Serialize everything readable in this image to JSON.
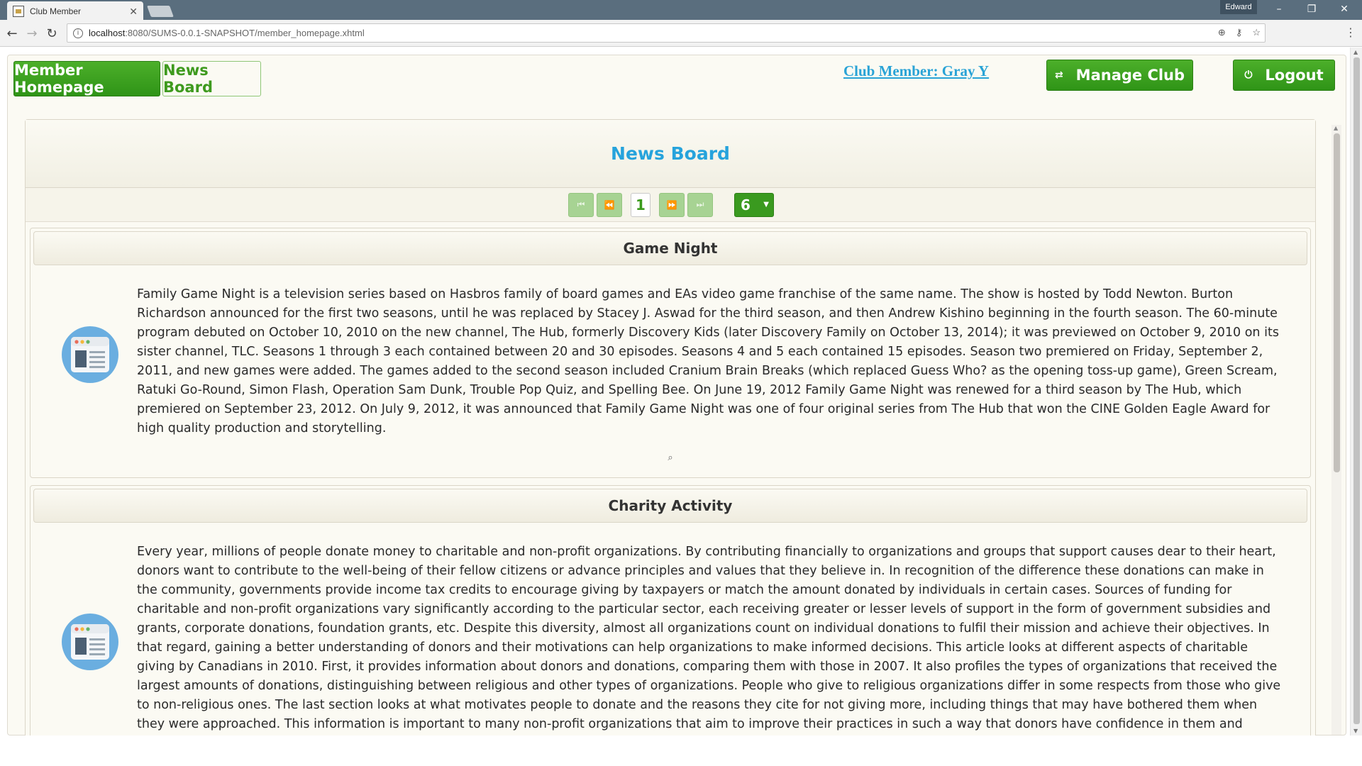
{
  "browser": {
    "tab_title": "Club Member",
    "profile_name": "Edward",
    "url_host": "localhost",
    "url_path": ":8080/SUMS-0.0.1-SNAPSHOT/member_homepage.xhtml"
  },
  "nav": {
    "member_homepage": "Member Homepage",
    "news_board": "News Board",
    "member_link": "Club Member: Gray Y",
    "manage_club": "Manage Club",
    "logout": "Logout"
  },
  "board": {
    "title": "News Board",
    "paginator": {
      "current_page": "1",
      "rows_per_page": "6"
    }
  },
  "news": [
    {
      "title": "Game Night",
      "body": "Family Game Night is a television series based on Hasbros family of board games and EAs video game franchise of the same name. The show is hosted by Todd Newton. Burton Richardson announced for the first two seasons, until he was replaced by Stacey J. Aswad for the third season, and then Andrew Kishino beginning in the fourth season. The 60-minute program debuted on October 10, 2010 on the new channel, The Hub, formerly Discovery Kids (later Discovery Family on October 13, 2014); it was previewed on October 9, 2010 on its sister channel, TLC. Seasons 1 through 3 each contained between 20 and 30 episodes. Seasons 4 and 5 each contained 15 episodes. Season two premiered on Friday, September 2, 2011, and new games were added. The games added to the second season included Cranium Brain Breaks (which replaced Guess Who? as the opening toss-up game), Green Scream, Ratuki Go-Round, Simon Flash, Operation Sam Dunk, Trouble Pop Quiz, and Spelling Bee. On June 19, 2012 Family Game Night was renewed for a third season by The Hub, which premiered on September 23, 2012. On July 9, 2012, it was announced that Family Game Night was one of four original series from The Hub that won the CINE Golden Eagle Award for high quality production and storytelling."
    },
    {
      "title": "Charity Activity",
      "body": "Every year, millions of people donate money to charitable and non-profit organizations. By contributing financially to organizations and groups that support causes dear to their heart, donors want to contribute to the well-being of their fellow citizens or advance principles and values that they believe in. In recognition of the difference these donations can make in the community, governments provide income tax credits to encourage giving by taxpayers or match the amount donated by individuals in certain cases. Sources of funding for charitable and non-profit organizations vary significantly according to the particular sector, each receiving greater or lesser levels of support in the form of government subsidies and grants, corporate donations, foundation grants, etc. Despite this diversity, almost all organizations count on individual donations to fulfil their mission and achieve their objectives. In that regard, gaining a better understanding of donors and their motivations can help organizations to make informed decisions. This article looks at different aspects of charitable giving by Canadians in 2010. First, it provides information about donors and donations, comparing them with those in 2007. It also profiles the types of organizations that received the largest amounts of donations, distinguishing between religious and other types of organizations. People who give to religious organizations differ in some respects from those who give to non-religious ones. The last section looks at what motivates people to donate and the reasons they cite for not giving more, including things that may have bothered them when they were approached. This information is important to many non-profit organizations that aim to improve their practices in such a way that donors have confidence in them and continue to give."
    }
  ],
  "icons": {
    "news_icon": "newspaper-icon",
    "more_icon": "magnifier-icon"
  },
  "colors": {
    "primary_green": "#3a9a1f",
    "title_blue": "#26a3dc",
    "page_bg": "#fbfaf3"
  }
}
